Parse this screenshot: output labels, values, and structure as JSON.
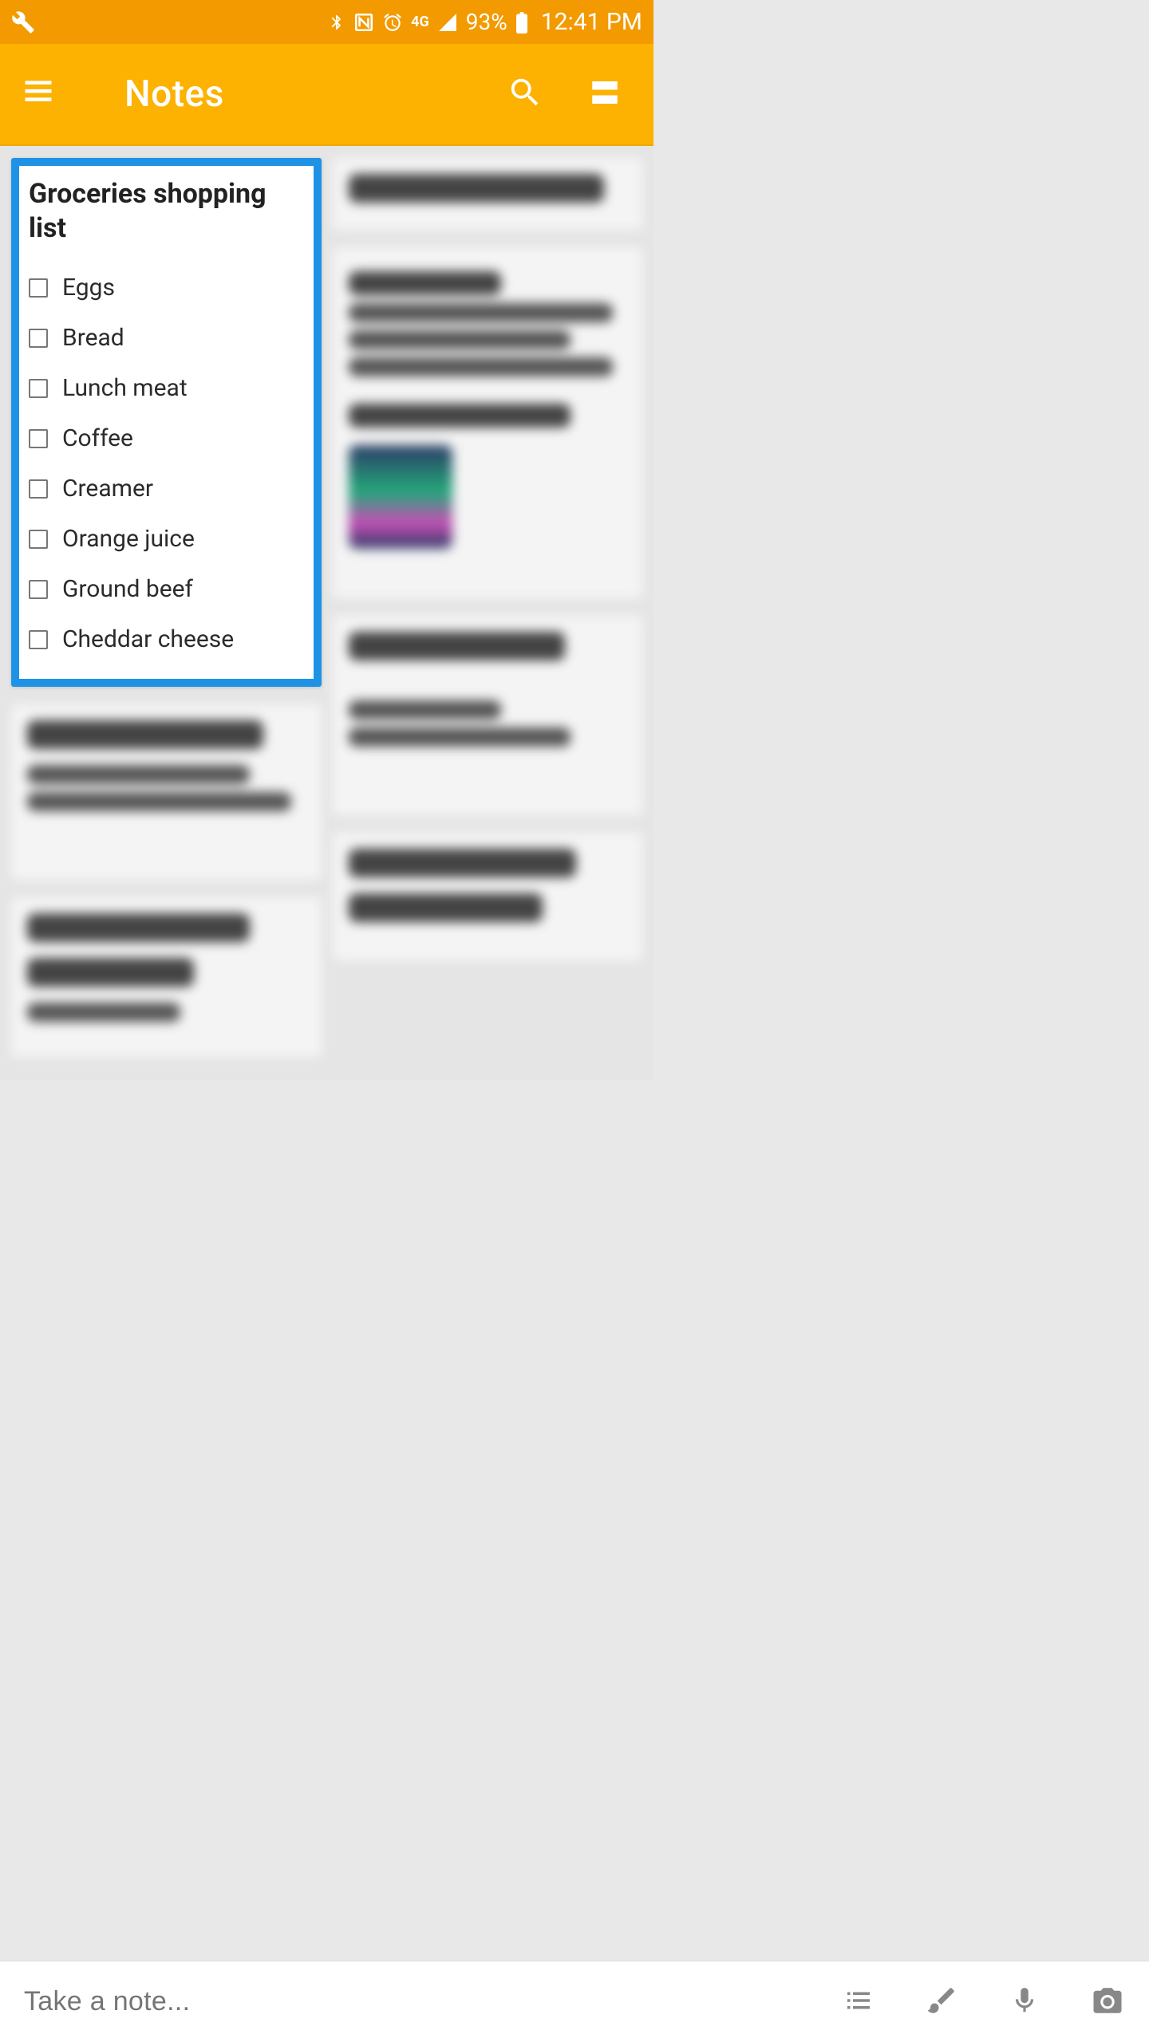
{
  "status_bar": {
    "battery_percent": "93%",
    "time": "12:41 PM"
  },
  "app_bar": {
    "title": "Notes"
  },
  "notes": {
    "selected": {
      "title": "Groceries shopping list",
      "items": [
        "Eggs",
        "Bread",
        "Lunch meat",
        "Coffee",
        "Creamer",
        "Orange juice",
        "Ground beef",
        "Cheddar cheese"
      ]
    }
  },
  "bottom_bar": {
    "placeholder": "Take a note..."
  }
}
